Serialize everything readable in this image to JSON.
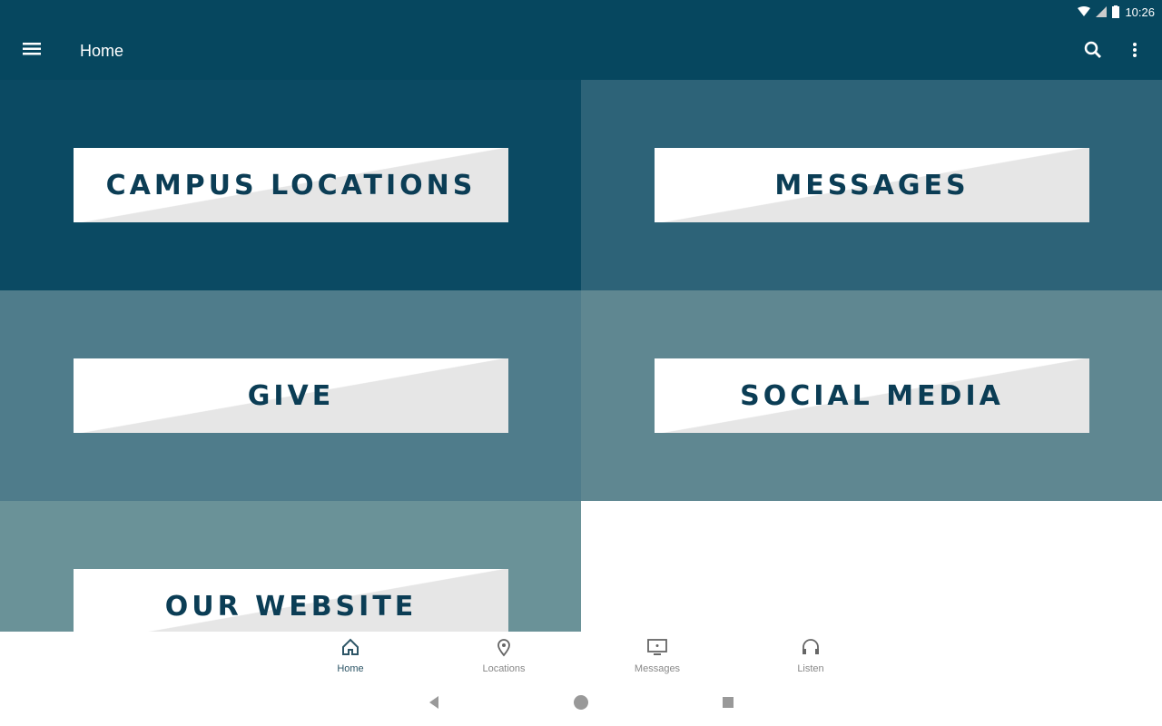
{
  "status_bar": {
    "time": "10:26",
    "icons": [
      "wifi-icon",
      "cell-signal-icon",
      "battery-icon"
    ]
  },
  "app_bar": {
    "title": "Home",
    "menu_icon": "hamburger-menu-icon",
    "search_icon": "search-icon",
    "more_icon": "more-vert-icon"
  },
  "tiles": [
    {
      "label": "CAMPUS LOCATIONS",
      "color": "#0b4a63"
    },
    {
      "label": "MESSAGES",
      "color": "#2d6378"
    },
    {
      "label": "GIVE",
      "color": "#4f7c8b"
    },
    {
      "label": "SOCIAL MEDIA",
      "color": "#5f8791"
    },
    {
      "label": "OUR WEBSITE",
      "color": "#6a9298"
    }
  ],
  "bottom_nav": [
    {
      "label": "Home",
      "icon": "home-icon",
      "active": true
    },
    {
      "label": "Locations",
      "icon": "location-pin-icon",
      "active": false
    },
    {
      "label": "Messages",
      "icon": "tv-icon",
      "active": false
    },
    {
      "label": "Listen",
      "icon": "headphones-icon",
      "active": false
    }
  ],
  "system_nav": {
    "back_icon": "back-icon",
    "home_icon": "home-circle-icon",
    "recents_icon": "recents-icon"
  },
  "colors": {
    "primary": "#06475f",
    "label_text": "#0b3d55"
  }
}
